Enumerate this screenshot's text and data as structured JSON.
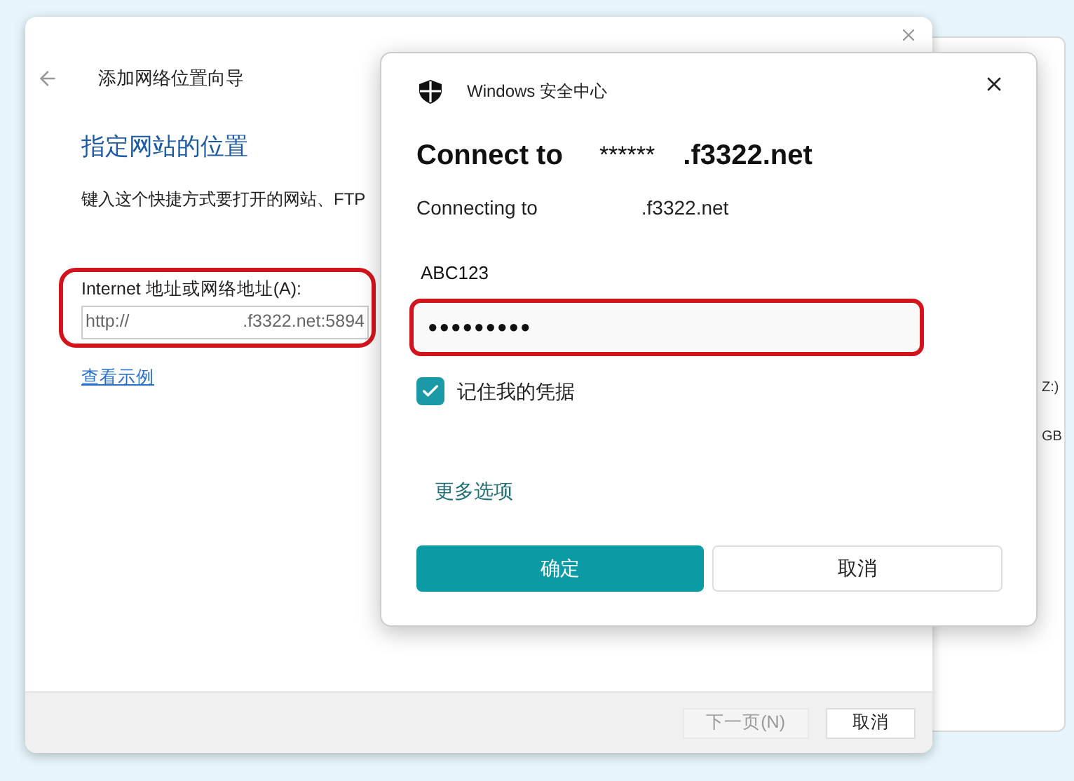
{
  "wizard": {
    "title": "添加网络位置向导",
    "heading": "指定网站的位置",
    "description": "键入这个快捷方式要打开的网站、FTP",
    "field_label": "Internet 地址或网络地址(A):",
    "field_value": [
      "http://",
      ".f3322.net:5894"
    ],
    "example_link": "查看示例",
    "buttons": [
      {
        "label": "下一页(N)",
        "disabled": true
      },
      {
        "label": "取消",
        "disabled": false
      }
    ]
  },
  "background_window": {
    "fragments": [
      "Z:)",
      "GB"
    ]
  },
  "dialog": {
    "title": "Windows 安全中心",
    "heading": [
      "Connect to",
      "******",
      ".f3322.net"
    ],
    "subtitle": [
      "Connecting to",
      ".f3322.net"
    ],
    "username": "ABC123",
    "password": "●●●●●●●●●",
    "remember": {
      "label": "记住我的凭据",
      "checked": true
    },
    "more_options": "更多选项",
    "buttons": [
      {
        "label": "确定",
        "kind": "primary"
      },
      {
        "label": "取消",
        "kind": "secondary"
      }
    ]
  }
}
